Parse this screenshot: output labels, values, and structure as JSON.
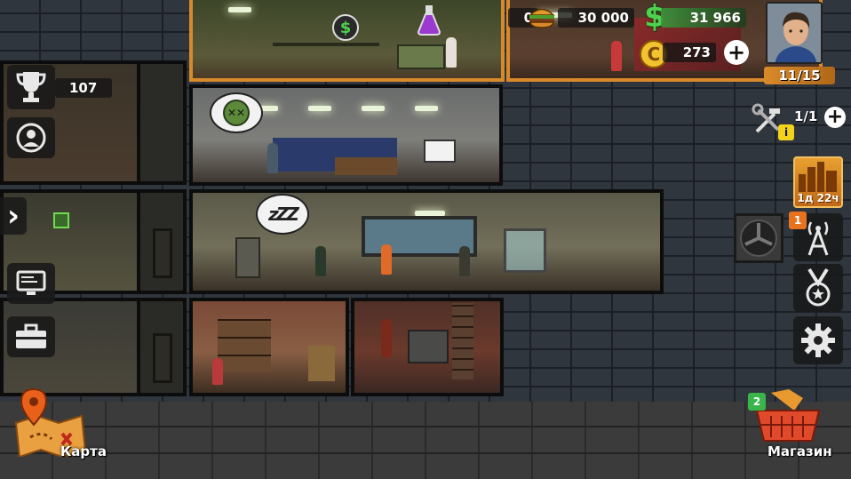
{
  "hud": {
    "trophies": "107",
    "food_left_value": "0",
    "food_value": "30 000",
    "cash_value": "31 966",
    "coins_value": "273",
    "survivors_count": "11/15",
    "builders_count": "1/1",
    "event_timer": "1д 22ч",
    "radio_badge": "1",
    "shop_badge": "2",
    "map_label": "Карта",
    "shop_label": "Магазин",
    "plus_symbol": "+",
    "cash_symbol": "$",
    "coin_symbol": "C",
    "info_symbol": "i",
    "chevron_symbol": "›"
  },
  "bubbles": {
    "sick_face": "✕✕",
    "sleep": "zZZ"
  },
  "colors": {
    "accent_orange": "#d88a2a",
    "cash_green": "#4fd04f",
    "coin_yellow": "#f2c230",
    "badge_orange": "#e8731e",
    "badge_green": "#3ab54a",
    "info_yellow": "#f2d21a"
  }
}
